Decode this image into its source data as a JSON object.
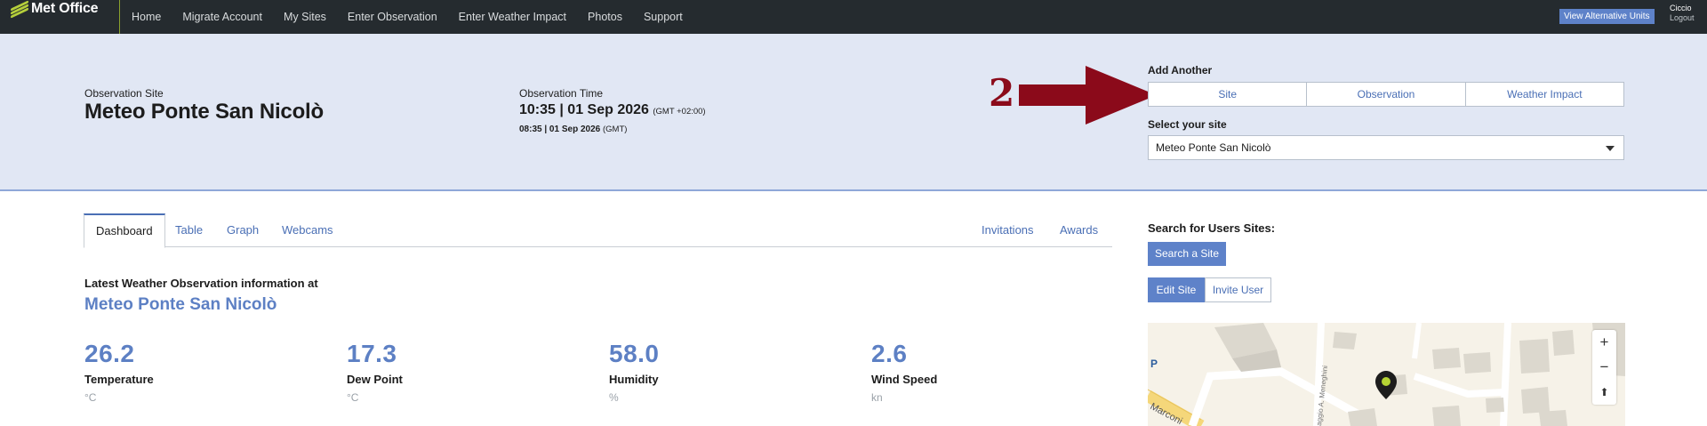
{
  "nav": {
    "logo_text": "Met Office",
    "items": [
      "Home",
      "Migrate Account",
      "My Sites",
      "Enter Observation",
      "Enter Weather Impact",
      "Photos",
      "Support"
    ],
    "alt_units_label": "View Alternative Units",
    "user_name": "Ciccio",
    "logout_label": "Logout"
  },
  "header": {
    "site_label": "Observation Site",
    "site_name": "Meteo Ponte San Nicolò",
    "time_label": "Observation Time",
    "time_main": "10:35 | 01 Sep 2026",
    "time_main_tz": "(GMT +02:00)",
    "time_sub": "08:35 | 01 Sep 2026",
    "time_sub_tz": "(GMT)",
    "annotation_number": "2",
    "add_another_label": "Add Another",
    "add_buttons": [
      "Site",
      "Observation",
      "Weather Impact"
    ],
    "select_label": "Select your site",
    "selected_site": "Meteo Ponte San Nicolò"
  },
  "tabs": {
    "left": [
      "Dashboard",
      "Table",
      "Graph",
      "Webcams"
    ],
    "right": [
      "Invitations",
      "Awards"
    ],
    "active": "Dashboard"
  },
  "latest": {
    "label": "Latest Weather Observation information at",
    "site": "Meteo Ponte San Nicolò"
  },
  "metrics": [
    {
      "value": "26.2",
      "name": "Temperature",
      "unit": "°C"
    },
    {
      "value": "17.3",
      "name": "Dew Point",
      "unit": "°C"
    },
    {
      "value": "58.0",
      "name": "Humidity",
      "unit": "%"
    },
    {
      "value": "2.6",
      "name": "Wind Speed",
      "unit": "kn"
    }
  ],
  "sidebar": {
    "search_label": "Search for Users Sites:",
    "search_button": "Search a Site",
    "edit_site_button": "Edit Site",
    "invite_user_button": "Invite User"
  },
  "map": {
    "street_1": "Marconi",
    "street_2": "aggio A. Meneghini",
    "poi_letter": "P",
    "zoom_in": "+",
    "zoom_out": "−",
    "compass": "⬆",
    "marker_color": "#b5d334"
  },
  "colors": {
    "nav_bg": "#252b2f",
    "header_bg": "#e1e7f4",
    "accent": "#5e82c9",
    "arrow": "#8b0a1a"
  }
}
